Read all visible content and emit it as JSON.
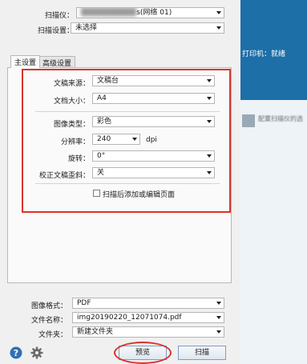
{
  "scanner": {
    "label": "扫描仪：",
    "value_suffix": "s(网络 01)"
  },
  "scan_settings": {
    "label": "扫描设置：",
    "value": "未选择"
  },
  "tabs": [
    {
      "label": "主设置"
    },
    {
      "label": "高级设置"
    }
  ],
  "fields": {
    "source": {
      "label": "文稿来源：",
      "value": "文稿台"
    },
    "size": {
      "label": "文档大小：",
      "value": "A4"
    },
    "image_type": {
      "label": "图像类型：",
      "value": "彩色"
    },
    "resolution": {
      "label": "分辨率：",
      "value": "240",
      "unit": "dpi"
    },
    "rotate": {
      "label": "旋转：",
      "value": "0°"
    },
    "skew": {
      "label": "校正文稿歪斜：",
      "value": "关"
    }
  },
  "add_edit_checkbox": {
    "label": "扫描后添加或编辑页面"
  },
  "output": {
    "format": {
      "label": "图像格式：",
      "value": "PDF"
    },
    "filename": {
      "label": "文件名称：",
      "value": "img20190220_12071074.pdf"
    },
    "folder": {
      "label": "文件夹：",
      "value": "新建文件夹"
    }
  },
  "buttons": {
    "preview": "预览",
    "scan": "扫描"
  },
  "background": {
    "status": "打印机：就绪",
    "line1": "配置扫描仪的选",
    "line2": ""
  },
  "colors": {
    "highlight_red": "#d9342b",
    "help_blue": "#2f6fb5"
  },
  "icons": {
    "help": "help-icon",
    "settings": "gear-icon"
  }
}
